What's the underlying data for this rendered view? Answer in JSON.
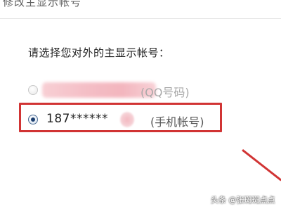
{
  "window": {
    "title": "修改主显示帐号"
  },
  "dialog": {
    "prompt": "请选择您对外的主显示帐号：",
    "options": [
      {
        "value": "",
        "type_label": "(QQ号码)",
        "selected": false,
        "value_redacted": true
      },
      {
        "value": "187******",
        "type_label": "(手机帐号)",
        "selected": true,
        "value_redacted": false
      }
    ]
  },
  "watermark": {
    "text": "头条 @张斑斑点点"
  },
  "colors": {
    "highlight": "#d13434",
    "radio_selected": "#1b3e6f",
    "redaction": "#f3b3bc"
  }
}
